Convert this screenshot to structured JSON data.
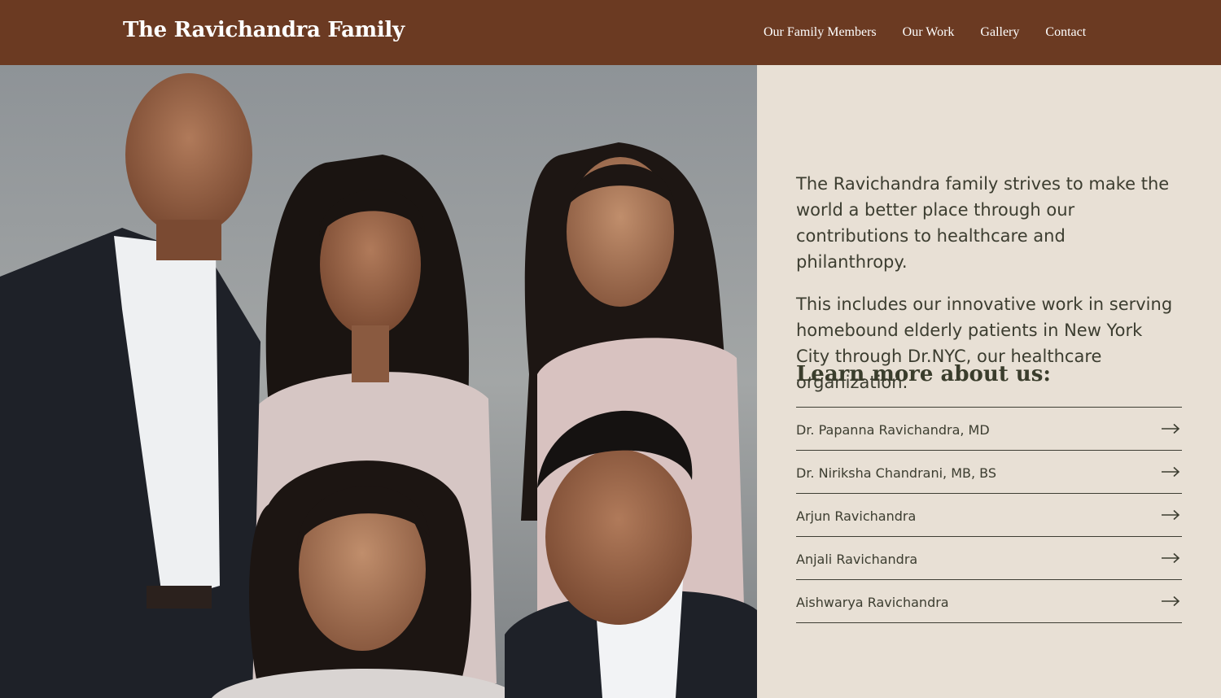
{
  "header": {
    "brand": "The Ravichandra Family",
    "nav": [
      "Our Family Members",
      "Our Work",
      "Gallery",
      "Contact"
    ]
  },
  "hero": {
    "image": "family-portrait-photo"
  },
  "main": {
    "paragraphs": [
      "The Ravichandra family strives to make the world a better place through our contributions to healthcare and philanthropy.",
      "This includes our innovative work in serving homebound elderly patients in New York City through Dr.NYC, our healthcare organization."
    ],
    "learn_heading": "Learn more about us:",
    "members": [
      "Dr. Papanna Ravichandra, MD",
      "Dr. Niriksha Chandrani, MB, BS",
      "Arjun Ravichandra",
      "Anjali Ravichandra",
      "Aishwarya Ravichandra"
    ],
    "arrow_icon": "arrow-right-icon"
  },
  "colors": {
    "header_bg": "#6b3a22",
    "panel_bg": "#e8e0d5",
    "text": "#3c3d30"
  }
}
